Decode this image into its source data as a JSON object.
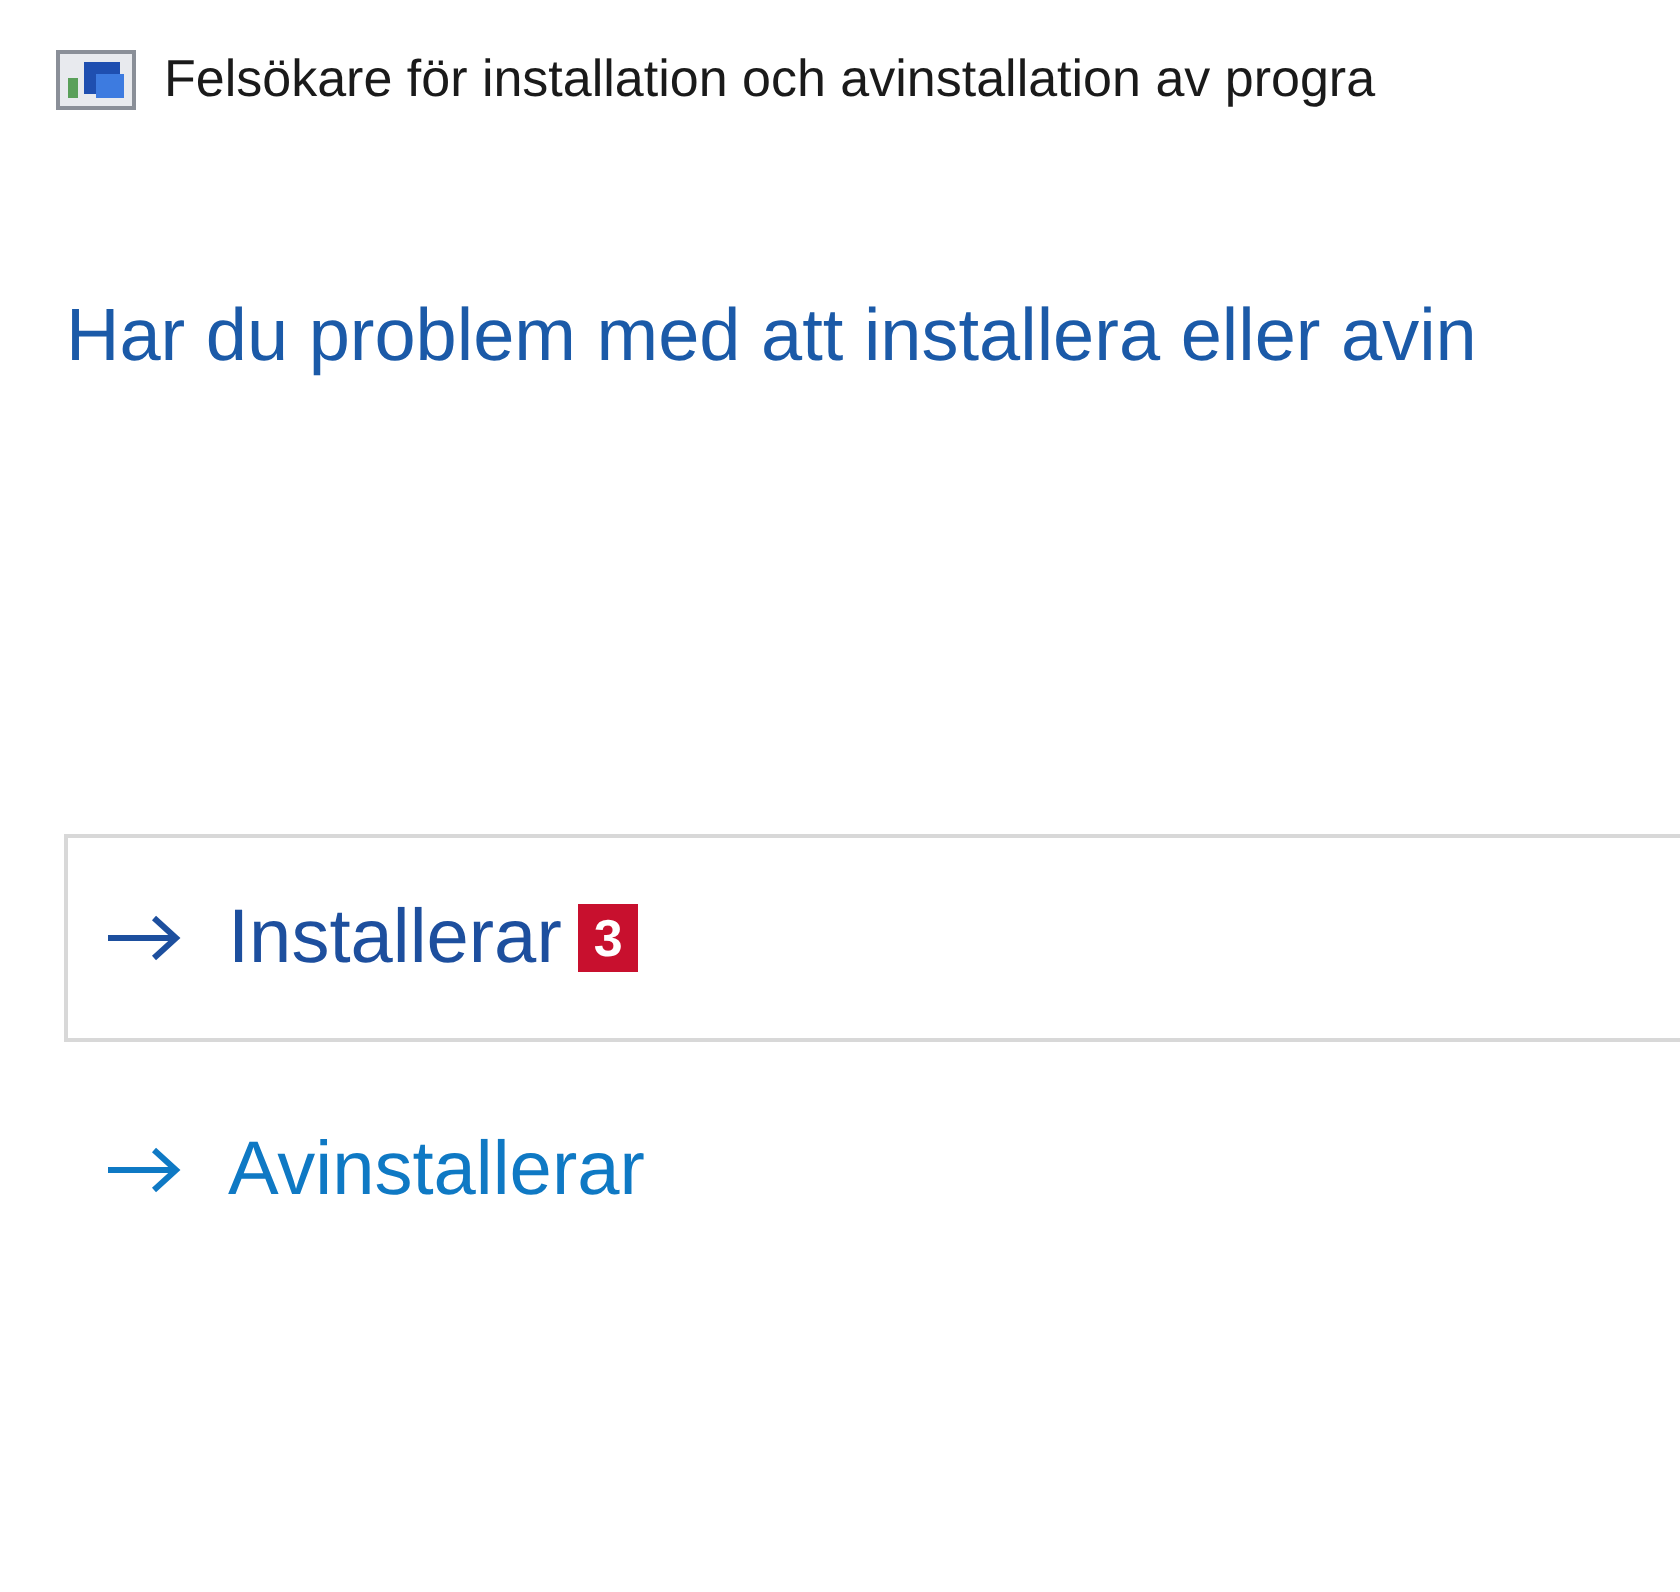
{
  "window": {
    "title": "Felsökare för installation och avinstallation av progra"
  },
  "heading": "Har du problem med att installera eller avin",
  "options": [
    {
      "label": "Installerar",
      "selected": true,
      "badge": "3"
    },
    {
      "label": "Avinstallerar",
      "selected": false
    }
  ]
}
